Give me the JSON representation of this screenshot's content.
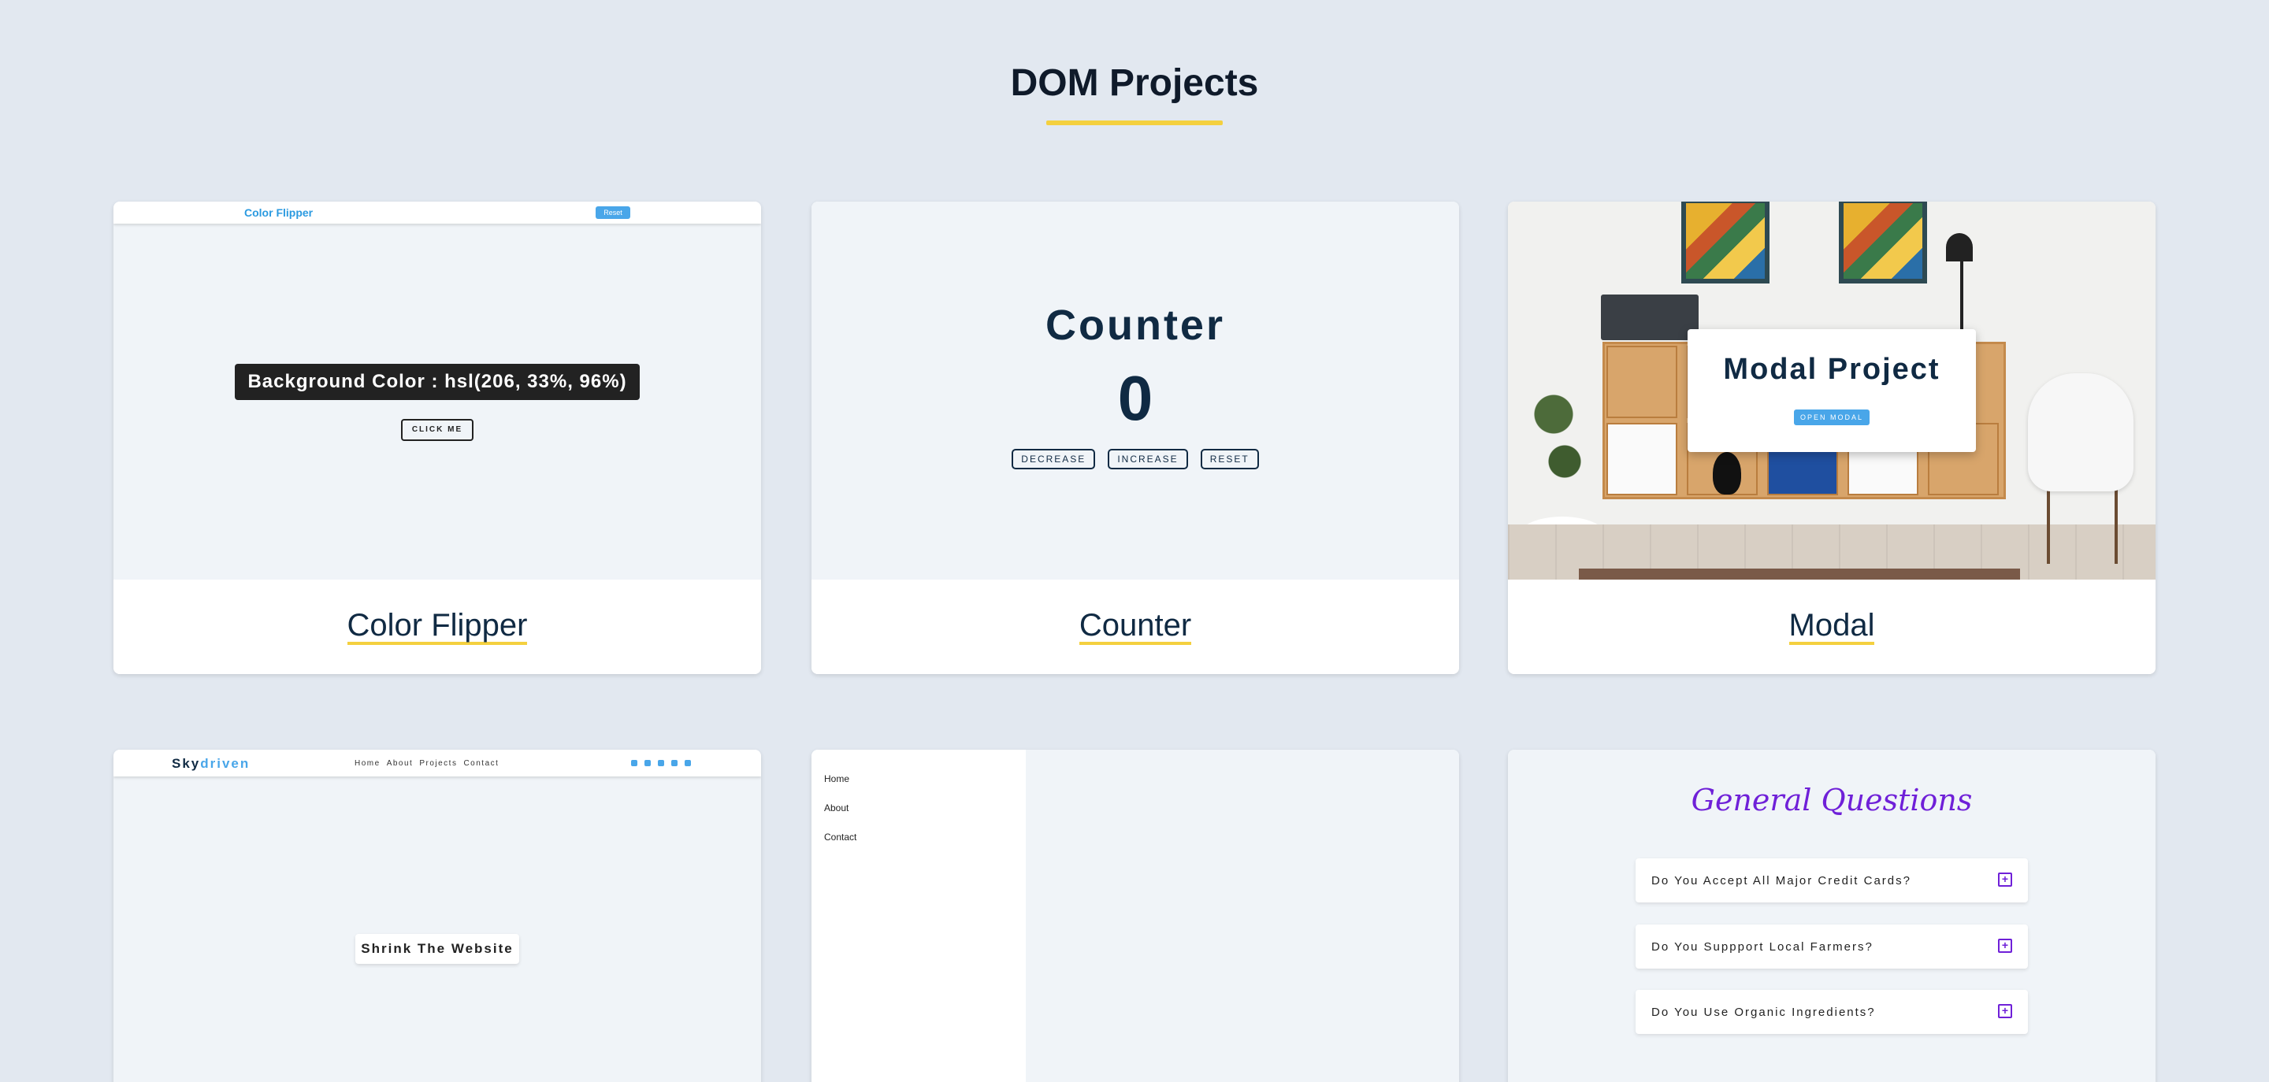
{
  "page": {
    "title": "DOM Projects"
  },
  "colors": {
    "accent_yellow": "#f4d03f",
    "blue": "#49a6e9",
    "navy": "#102a43",
    "purple": "#6f20d8"
  },
  "cards": {
    "color_flipper": {
      "label": "Color Flipper",
      "preview": {
        "logo": "Color Flipper",
        "reset_label": "Reset",
        "background_text": "Background Color : hsl(206, 33%, 96%)",
        "click_label": "CLICK ME"
      }
    },
    "counter": {
      "label": "Counter",
      "preview": {
        "title": "Counter",
        "value": "0",
        "decrease_label": "DECREASE",
        "increase_label": "INCREASE",
        "reset_label": "RESET"
      }
    },
    "modal": {
      "label": "Modal",
      "preview": {
        "title": "Modal Project",
        "open_label": "OPEN MODAL"
      }
    },
    "skydriven": {
      "preview": {
        "logo_main": "Sky",
        "logo_accent": "driven",
        "links": [
          "Home",
          "About",
          "Projects",
          "Contact"
        ],
        "socials": [
          "facebook-icon",
          "twitter-icon",
          "behance-icon",
          "linkedin-icon",
          "sketch-icon"
        ],
        "shrink_label": "Shrink The Website"
      }
    },
    "sidebar": {
      "preview": {
        "items": [
          "Home",
          "About",
          "Contact"
        ]
      }
    },
    "faq": {
      "preview": {
        "title": "General Questions",
        "questions": [
          "Do You Accept All Major Credit Cards?",
          "Do You Suppport Local Farmers?",
          "Do You Use Organic Ingredients?"
        ]
      }
    }
  }
}
